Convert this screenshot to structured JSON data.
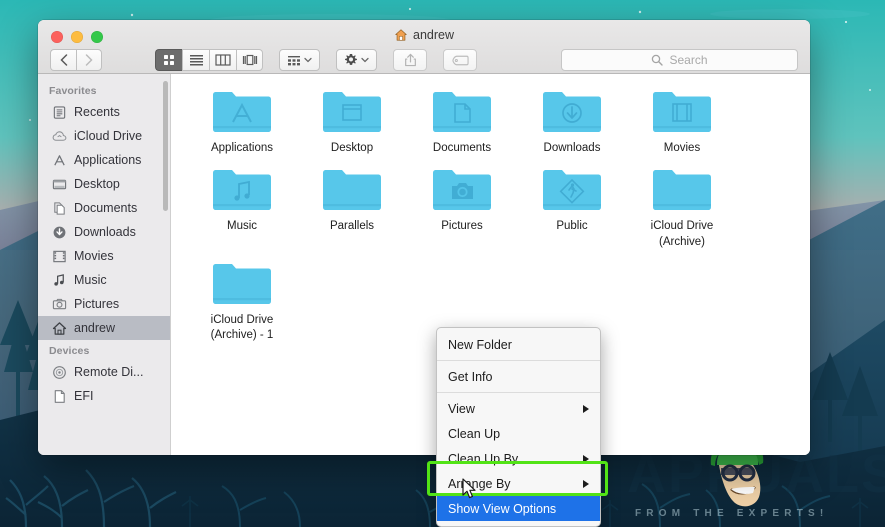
{
  "window": {
    "title": "andrew",
    "title_icon": "home-icon",
    "traffic_lights": [
      {
        "name": "close",
        "color": "#fc615d"
      },
      {
        "name": "minimize",
        "color": "#fdbc40"
      },
      {
        "name": "maximize",
        "color": "#34c84a"
      }
    ]
  },
  "toolbar": {
    "back_label": "‹",
    "forward_label": "›",
    "view_buttons": [
      {
        "name": "icon-view",
        "active": true
      },
      {
        "name": "list-view",
        "active": false
      },
      {
        "name": "column-view",
        "active": false
      },
      {
        "name": "gallery-view",
        "active": false
      }
    ],
    "arrange_label": "arrange-by-icon",
    "action_label": "gear-icon",
    "share_label": "share-icon",
    "tag_label": "tag-icon"
  },
  "search": {
    "placeholder": "Search",
    "value": ""
  },
  "sidebar": {
    "sections": [
      {
        "header": "Favorites",
        "items": [
          {
            "label": "Recents",
            "icon": "recents-icon",
            "selected": false
          },
          {
            "label": "iCloud Drive",
            "icon": "cloud-icon",
            "selected": false
          },
          {
            "label": "Applications",
            "icon": "applications-icon",
            "selected": false
          },
          {
            "label": "Desktop",
            "icon": "desktop-icon",
            "selected": false
          },
          {
            "label": "Documents",
            "icon": "documents-icon",
            "selected": false
          },
          {
            "label": "Downloads",
            "icon": "downloads-icon",
            "selected": false
          },
          {
            "label": "Movies",
            "icon": "movies-icon",
            "selected": false
          },
          {
            "label": "Music",
            "icon": "music-icon",
            "selected": false
          },
          {
            "label": "Pictures",
            "icon": "pictures-icon",
            "selected": false
          },
          {
            "label": "andrew",
            "icon": "home-icon",
            "selected": true
          }
        ]
      },
      {
        "header": "Devices",
        "items": [
          {
            "label": "Remote Di...",
            "icon": "disc-icon",
            "selected": false
          },
          {
            "label": "EFI",
            "icon": "drive-icon",
            "selected": false
          }
        ]
      }
    ]
  },
  "files": [
    {
      "name": "Applications",
      "glyph": "applications-glyph"
    },
    {
      "name": "Desktop",
      "glyph": "desktop-glyph"
    },
    {
      "name": "Documents",
      "glyph": "documents-glyph"
    },
    {
      "name": "Downloads",
      "glyph": "downloads-glyph"
    },
    {
      "name": "Movies",
      "glyph": "movies-glyph"
    },
    {
      "name": "Music",
      "glyph": "music-glyph"
    },
    {
      "name": "Parallels",
      "glyph": "plain-glyph"
    },
    {
      "name": "Pictures",
      "glyph": "camera-glyph"
    },
    {
      "name": "Public",
      "glyph": "public-glyph"
    },
    {
      "name": "iCloud Drive\n(Archive)",
      "glyph": "plain-glyph"
    },
    {
      "name": "iCloud Drive\n(Archive) - 1",
      "glyph": "plain-glyph"
    }
  ],
  "context_menu": {
    "items": [
      {
        "label": "New Folder",
        "submenu": false,
        "selected": false
      },
      {
        "label": "Get Info",
        "submenu": false,
        "selected": false
      },
      {
        "label": "View",
        "submenu": true,
        "selected": false
      },
      {
        "label": "Clean Up",
        "submenu": false,
        "selected": false
      },
      {
        "label": "Clean Up By",
        "submenu": true,
        "selected": false
      },
      {
        "label": "Arrange By",
        "submenu": true,
        "selected": false
      },
      {
        "label": "Show View Options",
        "submenu": false,
        "selected": true
      }
    ]
  },
  "annotation": {
    "color": "#52e316",
    "target": "Show View Options"
  },
  "watermark": {
    "brand": "APPUALS",
    "tagline": "FROM THE EXPERTS!"
  },
  "colors": {
    "folder": "#5ac6e8",
    "selection": "#1e72e8",
    "sidebar_selection": "#b9bcc4",
    "highlight_box": "#52e316"
  }
}
